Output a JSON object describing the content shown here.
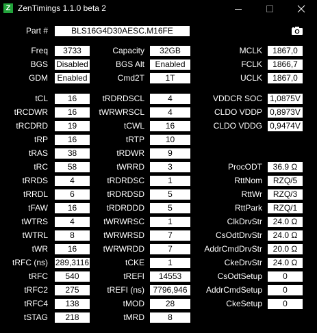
{
  "window": {
    "title": "ZenTimings 1.1.0 beta 2",
    "icon": "Z"
  },
  "part": {
    "label": "Part #",
    "value": "BLS16G4D30AESC.M16FE"
  },
  "top_left": [
    {
      "label": "Freq",
      "value": "3733"
    },
    {
      "label": "BGS",
      "value": "Disabled"
    },
    {
      "label": "GDM",
      "value": "Enabled"
    }
  ],
  "top_mid": [
    {
      "label": "Capacity",
      "value": "32GB"
    },
    {
      "label": "BGS Alt",
      "value": "Enabled"
    },
    {
      "label": "Cmd2T",
      "value": "1T"
    }
  ],
  "top_right": [
    {
      "label": "MCLK",
      "value": "1867,0"
    },
    {
      "label": "FCLK",
      "value": "1866,7"
    },
    {
      "label": "UCLK",
      "value": "1867,0"
    }
  ],
  "col1": [
    {
      "label": "tCL",
      "value": "16"
    },
    {
      "label": "tRCDWR",
      "value": "16"
    },
    {
      "label": "tRCDRD",
      "value": "19"
    },
    {
      "label": "tRP",
      "value": "16"
    },
    {
      "label": "tRAS",
      "value": "38"
    },
    {
      "label": "tRC",
      "value": "58"
    },
    {
      "label": "tRRDS",
      "value": "4"
    },
    {
      "label": "tRRDL",
      "value": "6"
    },
    {
      "label": "tFAW",
      "value": "16"
    },
    {
      "label": "tWTRS",
      "value": "4"
    },
    {
      "label": "tWTRL",
      "value": "8"
    },
    {
      "label": "tWR",
      "value": "16"
    },
    {
      "label": "tRFC (ns)",
      "value": "289,3116"
    },
    {
      "label": "tRFC",
      "value": "540"
    },
    {
      "label": "tRFC2",
      "value": "275"
    },
    {
      "label": "tRFC4",
      "value": "138"
    },
    {
      "label": "tSTAG",
      "value": "218"
    }
  ],
  "col2": [
    {
      "label": "tRDRDSCL",
      "value": "4"
    },
    {
      "label": "tWRWRSCL",
      "value": "4"
    },
    {
      "label": "tCWL",
      "value": "16"
    },
    {
      "label": "tRTP",
      "value": "10"
    },
    {
      "label": "tRDWR",
      "value": "9"
    },
    {
      "label": "tWRRD",
      "value": "3"
    },
    {
      "label": "tRDRDSC",
      "value": "1"
    },
    {
      "label": "tRDRDSD",
      "value": "5"
    },
    {
      "label": "tRDRDDD",
      "value": "5"
    },
    {
      "label": "tWRWRSC",
      "value": "1"
    },
    {
      "label": "tWRWRSD",
      "value": "7"
    },
    {
      "label": "tWRWRDD",
      "value": "7"
    },
    {
      "label": "tCKE",
      "value": "1"
    },
    {
      "label": "tREFI",
      "value": "14553"
    },
    {
      "label": "tREFI (ns)",
      "value": "7796,946"
    },
    {
      "label": "tMOD",
      "value": "28"
    },
    {
      "label": "tMRD",
      "value": "8"
    }
  ],
  "col3a": [
    {
      "label": "VDDCR SOC",
      "value": "1,0875V"
    },
    {
      "label": "CLDO VDDP",
      "value": "0,8973V"
    },
    {
      "label": "CLDO VDDG",
      "value": "0,9474V"
    }
  ],
  "col3b": [
    {
      "label": "ProcODT",
      "value": "36.9 Ω"
    },
    {
      "label": "RttNom",
      "value": "RZQ/5"
    },
    {
      "label": "RttWr",
      "value": "RZQ/3"
    },
    {
      "label": "RttPark",
      "value": "RZQ/1"
    },
    {
      "label": "ClkDrvStr",
      "value": "24.0 Ω"
    },
    {
      "label": "CsOdtDrvStr",
      "value": "24.0 Ω"
    },
    {
      "label": "AddrCmdDrvStr",
      "value": "20.0 Ω"
    },
    {
      "label": "CkeDrvStr",
      "value": "24.0 Ω"
    },
    {
      "label": "CsOdtSetup",
      "value": "0"
    },
    {
      "label": "AddrCmdSetup",
      "value": "0"
    },
    {
      "label": "CkeSetup",
      "value": "0"
    }
  ],
  "icons": {
    "screenshot": "camera-icon",
    "minimize": "minimize-icon",
    "maximize": "maximize-icon",
    "close": "close-icon"
  },
  "colors": {
    "background": "#000000",
    "field": "#ffffff",
    "app_icon": "#22a33b"
  }
}
